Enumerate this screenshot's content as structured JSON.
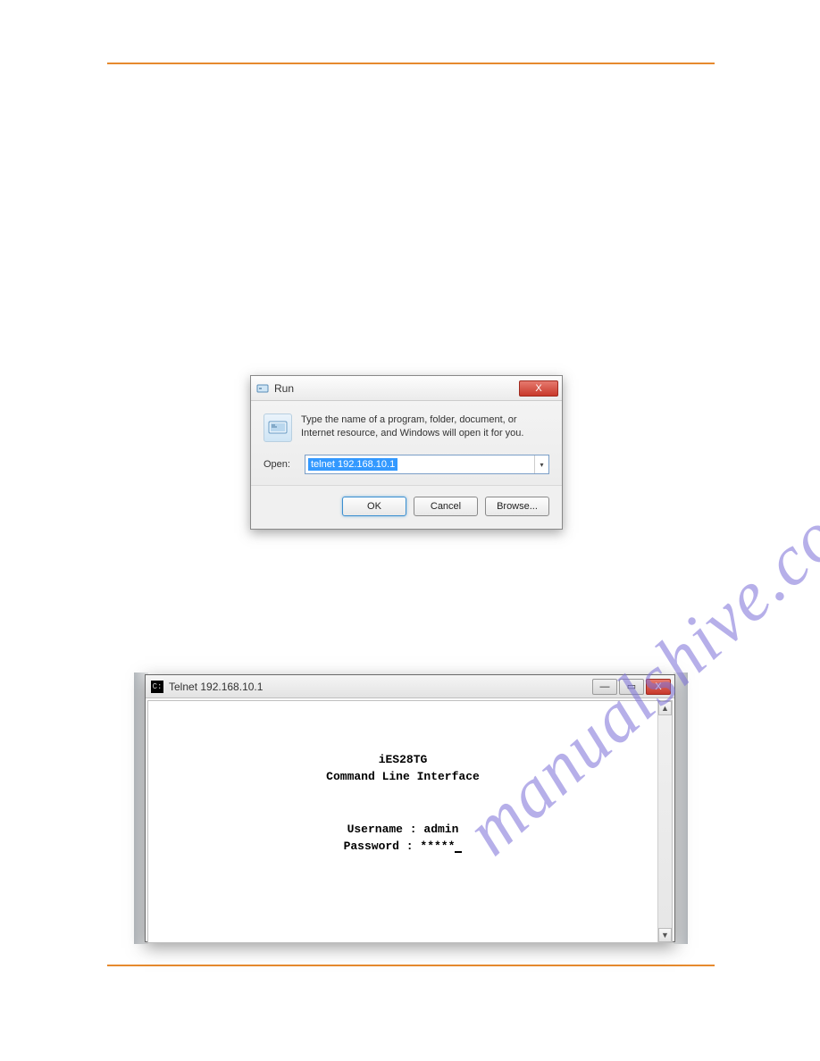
{
  "watermark": "manualshive.com",
  "run_dialog": {
    "title": "Run",
    "close_aria": "X",
    "description": "Type the name of a program, folder, document, or Internet resource, and Windows will open it for you.",
    "open_label": "Open:",
    "open_value": "telnet 192.168.10.1",
    "buttons": {
      "ok": "OK",
      "cancel": "Cancel",
      "browse": "Browse..."
    }
  },
  "telnet_window": {
    "title": "Telnet 192.168.10.1",
    "controls": {
      "minimize": "—",
      "maximize": "▭",
      "close": "X"
    },
    "lines": {
      "product": "iES28TG",
      "subtitle": "Command Line Interface",
      "user_label": "Username :",
      "user_value": "admin",
      "pass_label": "Password :",
      "pass_value": "*****"
    },
    "scroll": {
      "up": "▲",
      "down": "▼"
    }
  }
}
